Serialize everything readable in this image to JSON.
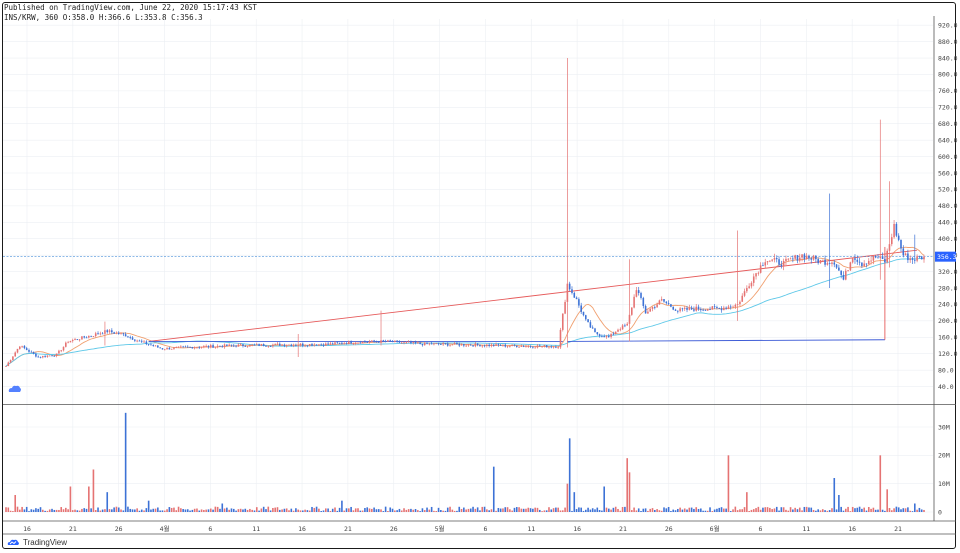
{
  "header": {
    "published": "Published on TradingView.com, June 22, 2020 15:17:43 KST",
    "ohlc": "INS/KRW, 360 O:358.0 H:366.6 L:353.8 C:356.3"
  },
  "footer": {
    "brand": "TradingView"
  },
  "colors": {
    "up": "#e57373",
    "down": "#3d72d6",
    "ma_fast": "#f0a070",
    "ma_slow": "#5ec8e8",
    "trend": "#e65a5a",
    "line_blue": "#3d5bd6",
    "current_price": "#4a90d9",
    "grid": "#eceff3",
    "border": "#1a1a1a"
  },
  "chart_data": {
    "type": "candlestick",
    "symbol": "INS/KRW",
    "interval": "360",
    "current_price": 356.3,
    "current_price_label": "356.3",
    "ylim": [
      0,
      935
    ],
    "y_ticks": [
      40,
      80,
      120,
      160,
      200,
      240,
      280,
      320,
      360,
      400,
      440,
      480,
      520,
      560,
      600,
      640,
      680,
      720,
      760,
      800,
      840,
      880,
      920
    ],
    "y_tick_labels": [
      "40.0",
      "80.0",
      "120.0",
      "160.0",
      "200.0",
      "240.0",
      "280.0",
      "320.0",
      "360.0",
      "400.0",
      "440.0",
      "480.0",
      "520.0",
      "560.0",
      "600.0",
      "640.0",
      "680.0",
      "720.0",
      "760.0",
      "800.0",
      "840.0",
      "880.0",
      "920.0"
    ],
    "x_labels": [
      "16",
      "21",
      "26",
      "4월",
      "6",
      "11",
      "16",
      "21",
      "26",
      "5월",
      "6",
      "11",
      "16",
      "21",
      "26",
      "6월",
      "6",
      "11",
      "16",
      "21"
    ],
    "volume_ticks": [
      0,
      10,
      20,
      30
    ],
    "volume_tick_labels": [
      "0",
      "10M",
      "20M",
      "30M"
    ],
    "anchors": [
      {
        "i": 0,
        "v": 90
      },
      {
        "i": 6,
        "v": 140
      },
      {
        "i": 14,
        "v": 112
      },
      {
        "i": 22,
        "v": 118
      },
      {
        "i": 27,
        "v": 150
      },
      {
        "i": 34,
        "v": 160
      },
      {
        "i": 44,
        "v": 175
      },
      {
        "i": 52,
        "v": 165
      },
      {
        "i": 58,
        "v": 150
      },
      {
        "i": 68,
        "v": 132
      },
      {
        "i": 80,
        "v": 136
      },
      {
        "i": 100,
        "v": 140
      },
      {
        "i": 120,
        "v": 142
      },
      {
        "i": 140,
        "v": 143
      },
      {
        "i": 150,
        "v": 148
      },
      {
        "i": 165,
        "v": 150
      },
      {
        "i": 180,
        "v": 144
      },
      {
        "i": 200,
        "v": 142
      },
      {
        "i": 215,
        "v": 140
      },
      {
        "i": 230,
        "v": 138
      },
      {
        "i": 240,
        "v": 138
      },
      {
        "i": 244,
        "v": 290
      },
      {
        "i": 248,
        "v": 250
      },
      {
        "i": 252,
        "v": 200
      },
      {
        "i": 256,
        "v": 170
      },
      {
        "i": 262,
        "v": 160
      },
      {
        "i": 266,
        "v": 180
      },
      {
        "i": 270,
        "v": 190
      },
      {
        "i": 274,
        "v": 280
      },
      {
        "i": 278,
        "v": 220
      },
      {
        "i": 285,
        "v": 250
      },
      {
        "i": 292,
        "v": 225
      },
      {
        "i": 300,
        "v": 230
      },
      {
        "i": 310,
        "v": 230
      },
      {
        "i": 318,
        "v": 240
      },
      {
        "i": 324,
        "v": 300
      },
      {
        "i": 330,
        "v": 350
      },
      {
        "i": 338,
        "v": 340
      },
      {
        "i": 346,
        "v": 360
      },
      {
        "i": 354,
        "v": 345
      },
      {
        "i": 360,
        "v": 345
      },
      {
        "i": 364,
        "v": 300
      },
      {
        "i": 368,
        "v": 360
      },
      {
        "i": 372,
        "v": 340
      },
      {
        "i": 378,
        "v": 355
      },
      {
        "i": 382,
        "v": 345
      },
      {
        "i": 386,
        "v": 430
      },
      {
        "i": 390,
        "v": 360
      },
      {
        "i": 394,
        "v": 350
      },
      {
        "i": 399,
        "v": 356.3
      }
    ],
    "spikes": [
      {
        "i": 43,
        "h": 198,
        "l": 140
      },
      {
        "i": 127,
        "h": 168,
        "l": 112
      },
      {
        "i": 163,
        "h": 225,
        "l": 140
      },
      {
        "i": 244,
        "h": 840,
        "l": 135
      },
      {
        "i": 271,
        "h": 350,
        "l": 150
      },
      {
        "i": 318,
        "h": 420,
        "l": 200
      },
      {
        "i": 358,
        "h": 510,
        "l": 280
      },
      {
        "i": 380,
        "h": 690,
        "l": 300
      },
      {
        "i": 384,
        "h": 540,
        "l": 330
      },
      {
        "i": 395,
        "h": 410,
        "l": 340
      }
    ],
    "volume_spikes": [
      {
        "i": 4,
        "v": 6
      },
      {
        "i": 28,
        "v": 9
      },
      {
        "i": 36,
        "v": 9
      },
      {
        "i": 38,
        "v": 15
      },
      {
        "i": 44,
        "v": 7
      },
      {
        "i": 52,
        "v": 35
      },
      {
        "i": 62,
        "v": 4
      },
      {
        "i": 94,
        "v": 3
      },
      {
        "i": 146,
        "v": 4
      },
      {
        "i": 212,
        "v": 16
      },
      {
        "i": 244,
        "v": 10
      },
      {
        "i": 245,
        "v": 26
      },
      {
        "i": 247,
        "v": 7
      },
      {
        "i": 260,
        "v": 9
      },
      {
        "i": 270,
        "v": 19
      },
      {
        "i": 271,
        "v": 14
      },
      {
        "i": 314,
        "v": 20
      },
      {
        "i": 322,
        "v": 7
      },
      {
        "i": 360,
        "v": 12
      },
      {
        "i": 362,
        "v": 6
      },
      {
        "i": 380,
        "v": 20
      },
      {
        "i": 383,
        "v": 8
      },
      {
        "i": 395,
        "v": 3
      }
    ],
    "trendlines": [
      {
        "from": [
          62,
          150
        ],
        "to": [
          396,
          372
        ],
        "color": "trend"
      },
      {
        "from": [
          62,
          150
        ],
        "to": [
          242,
          150
        ],
        "color": "line_blue"
      },
      {
        "from": [
          244,
          150
        ],
        "to": [
          382,
          154
        ],
        "color": "line_blue"
      },
      {
        "from": [
          382,
          154
        ],
        "to": [
          382,
          380
        ],
        "color": "trend"
      }
    ]
  }
}
